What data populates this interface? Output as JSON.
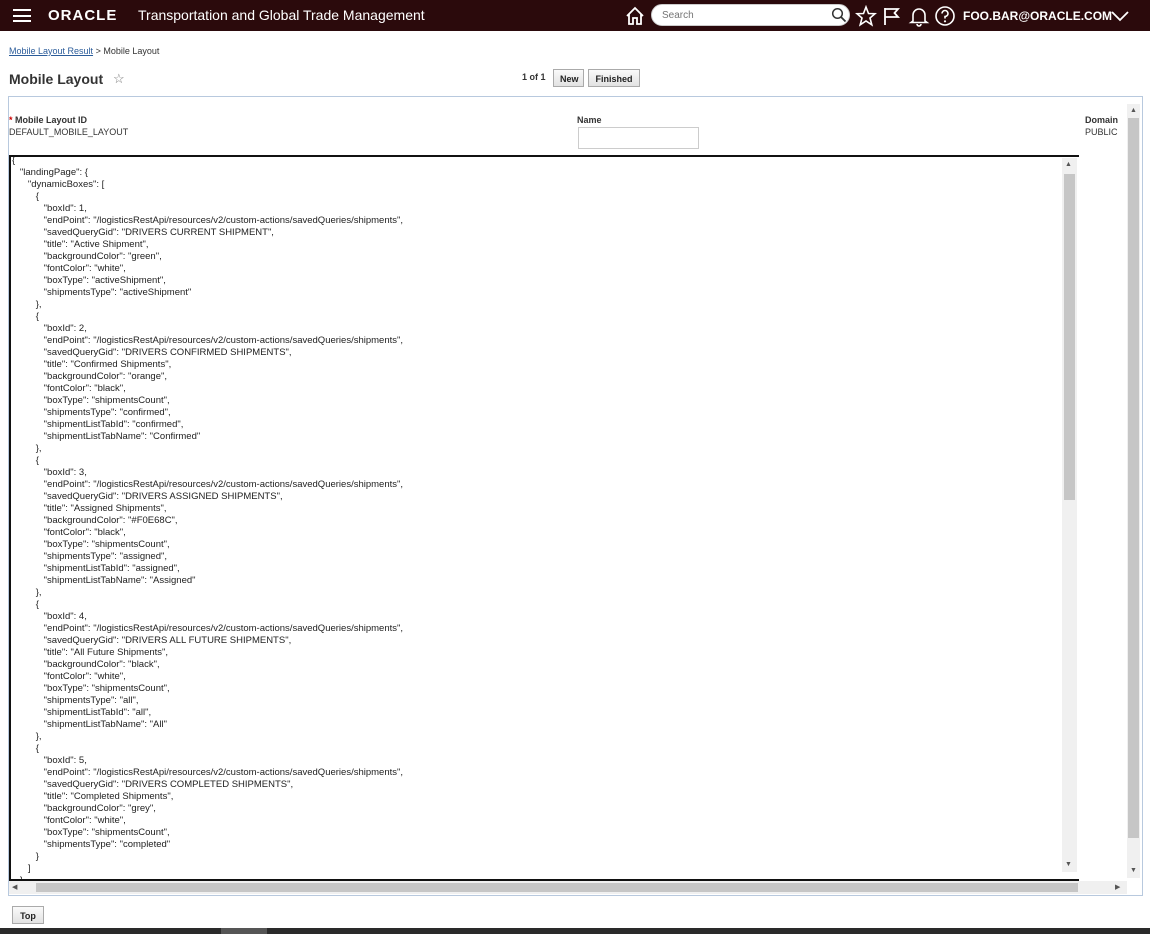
{
  "header": {
    "brand": "ORACLE",
    "app_title": "Transportation and Global Trade Management",
    "search_placeholder": "Search",
    "user": "FOO.BAR@ORACLE.COM",
    "icons": [
      "menu-icon",
      "home-icon",
      "search-icon",
      "star-icon",
      "flag-icon",
      "bell-icon",
      "help-icon",
      "chevron-down-icon"
    ]
  },
  "breadcrumb": {
    "link": "Mobile Layout Result",
    "separator": ">",
    "current": "Mobile Layout"
  },
  "page": {
    "title": "Mobile Layout",
    "favorite_icon": "☆",
    "pager": "1 of 1",
    "new_label": "New",
    "finished_label": "Finished"
  },
  "form": {
    "required_mark": "*",
    "id_label": "Mobile Layout ID",
    "id_value": "DEFAULT_MOBILE_LAYOUT",
    "name_label": "Name",
    "name_value": "",
    "domain_label": "Domain",
    "domain_value": "PUBLIC"
  },
  "json_content": "{\n   \"landingPage\": {\n      \"dynamicBoxes\": [\n         {\n            \"boxId\": 1,\n            \"endPoint\": \"/logisticsRestApi/resources/v2/custom-actions/savedQueries/shipments\",\n            \"savedQueryGid\": \"DRIVERS CURRENT SHIPMENT\",\n            \"title\": \"Active Shipment\",\n            \"backgroundColor\": \"green\",\n            \"fontColor\": \"white\",\n            \"boxType\": \"activeShipment\",\n            \"shipmentsType\": \"activeShipment\"\n         },\n         {\n            \"boxId\": 2,\n            \"endPoint\": \"/logisticsRestApi/resources/v2/custom-actions/savedQueries/shipments\",\n            \"savedQueryGid\": \"DRIVERS CONFIRMED SHIPMENTS\",\n            \"title\": \"Confirmed Shipments\",\n            \"backgroundColor\": \"orange\",\n            \"fontColor\": \"black\",\n            \"boxType\": \"shipmentsCount\",\n            \"shipmentsType\": \"confirmed\",\n            \"shipmentListTabId\": \"confirmed\",\n            \"shipmentListTabName\": \"Confirmed\"\n         },\n         {\n            \"boxId\": 3,\n            \"endPoint\": \"/logisticsRestApi/resources/v2/custom-actions/savedQueries/shipments\",\n            \"savedQueryGid\": \"DRIVERS ASSIGNED SHIPMENTS\",\n            \"title\": \"Assigned Shipments\",\n            \"backgroundColor\": \"#F0E68C\",\n            \"fontColor\": \"black\",\n            \"boxType\": \"shipmentsCount\",\n            \"shipmentsType\": \"assigned\",\n            \"shipmentListTabId\": \"assigned\",\n            \"shipmentListTabName\": \"Assigned\"\n         },\n         {\n            \"boxId\": 4,\n            \"endPoint\": \"/logisticsRestApi/resources/v2/custom-actions/savedQueries/shipments\",\n            \"savedQueryGid\": \"DRIVERS ALL FUTURE SHIPMENTS\",\n            \"title\": \"All Future Shipments\",\n            \"backgroundColor\": \"black\",\n            \"fontColor\": \"white\",\n            \"boxType\": \"shipmentsCount\",\n            \"shipmentsType\": \"all\",\n            \"shipmentListTabId\": \"all\",\n            \"shipmentListTabName\": \"All\"\n         },\n         {\n            \"boxId\": 5,\n            \"endPoint\": \"/logisticsRestApi/resources/v2/custom-actions/savedQueries/shipments\",\n            \"savedQueryGid\": \"DRIVERS COMPLETED SHIPMENTS\",\n            \"title\": \"Completed Shipments\",\n            \"backgroundColor\": \"grey\",\n            \"fontColor\": \"white\",\n            \"boxType\": \"shipmentsCount\",\n            \"shipmentsType\": \"completed\"\n         }\n      ]\n   }",
  "footer": {
    "top_label": "Top"
  },
  "colors": {
    "header_bg": "#2b0a0c",
    "link": "#2b5c9a",
    "required": "#cc0000"
  }
}
